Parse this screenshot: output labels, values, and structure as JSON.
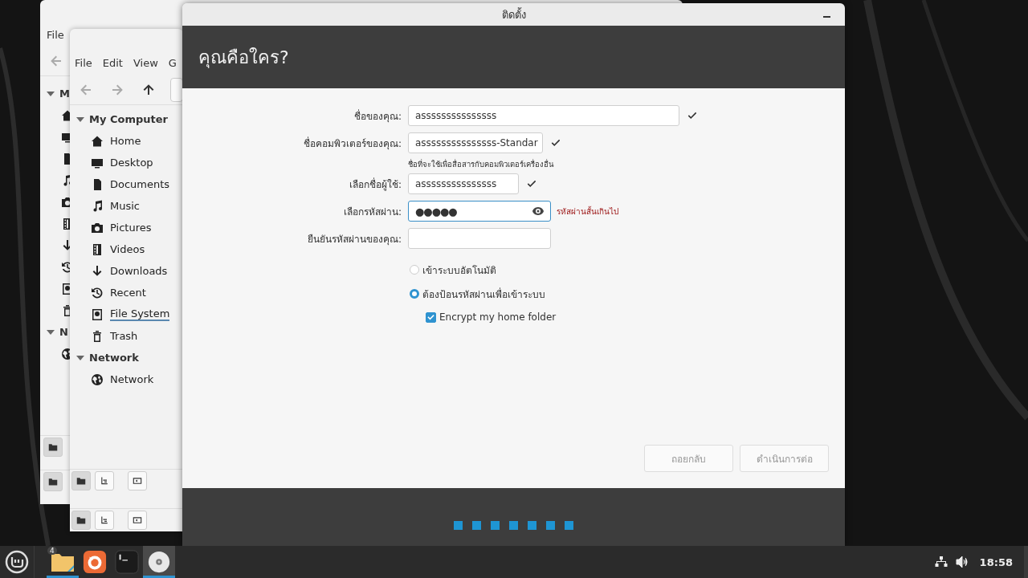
{
  "back_window": {
    "menu": [
      "File"
    ],
    "headings": [
      "M",
      "N"
    ]
  },
  "file_manager": {
    "menu": [
      "File",
      "Edit",
      "View",
      "G"
    ],
    "sections": [
      {
        "heading": "My Computer",
        "expanded": true,
        "items": [
          {
            "label": "Home",
            "selected": false
          },
          {
            "label": "Desktop",
            "selected": false
          },
          {
            "label": "Documents",
            "selected": false
          },
          {
            "label": "Music",
            "selected": false
          },
          {
            "label": "Pictures",
            "selected": false
          },
          {
            "label": "Videos",
            "selected": false
          },
          {
            "label": "Downloads",
            "selected": false
          },
          {
            "label": "Recent",
            "selected": false
          },
          {
            "label": "File System",
            "selected": true
          },
          {
            "label": "Trash",
            "selected": false
          }
        ]
      },
      {
        "heading": "Network",
        "expanded": true,
        "items": [
          {
            "label": "Network",
            "selected": false
          }
        ]
      }
    ]
  },
  "installer": {
    "title": "ติดตั้ง",
    "heading": "คุณคือใคร?",
    "fields": [
      {
        "label": "ชื่อของคุณ:",
        "value": "asssssssssssssss",
        "valid": true,
        "focused": false
      },
      {
        "label": "ชื่อคอมพิวเตอร์ของคุณ:",
        "value": "asssssssssssssss-Standar",
        "valid": true,
        "focused": false,
        "hint": "ชื่อที่จะใช้เพื่อสื่อสารกับคอมพิวเตอร์เครื่องอื่น"
      },
      {
        "label": "เลือกชื่อผู้ใช้:",
        "value": "asssssssssssssss",
        "valid": true,
        "focused": false
      },
      {
        "label": "เลือกรหัสผ่าน:",
        "value": "●●●●●",
        "valid": false,
        "focused": true,
        "error": "รหัสผ่านสั้นเกินไป"
      },
      {
        "label": "ยืนยันรหัสผ่านของคุณ:",
        "valid": false,
        "focused": false
      }
    ],
    "login_options": [
      {
        "label": "เข้าระบบอัตโนมัติ",
        "selected": false
      },
      {
        "label": "ต้องป้อนรหัสผ่านเพื่อเข้าระบบ",
        "selected": true
      }
    ],
    "encrypt": {
      "label": "Encrypt my home folder",
      "checked": true
    },
    "buttons": [
      {
        "label": "ถอยกลับ",
        "disabled": true
      },
      {
        "label": "ดำเนินการต่อ",
        "disabled": true
      }
    ]
  },
  "taskbar": {
    "apps": [
      {
        "badge": "4",
        "running": true,
        "selected": false
      },
      {
        "running": false,
        "selected": false
      },
      {
        "running": false,
        "selected": false
      },
      {
        "running": true,
        "selected": true
      }
    ],
    "clock": "18:58"
  }
}
